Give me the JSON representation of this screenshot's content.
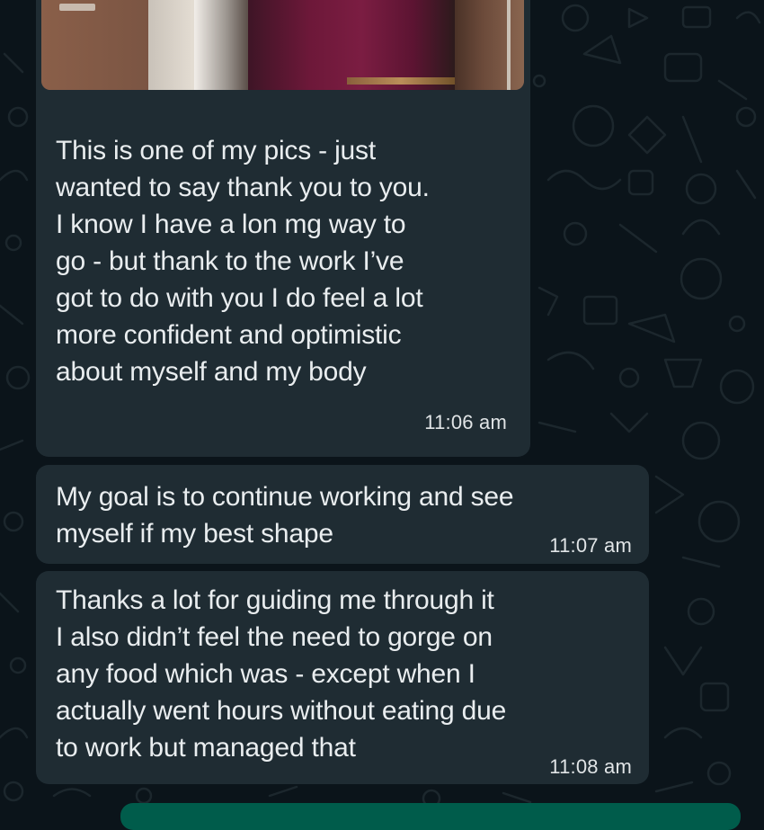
{
  "theme": {
    "background": "#0b141a",
    "incoming_bubble": "#1f2c33",
    "outgoing_bubble": "#005c4b",
    "text": "#e9edef"
  },
  "messages": [
    {
      "type": "image_with_caption",
      "direction": "incoming",
      "text": "This is one of my pics - just\nwanted to say thank you to you.\nI know I have a lon mg way to\ngo - but thank to the work I’ve\ngot to do with you I do feel a lot\nmore confident and optimistic\nabout myself and my body",
      "time": "11:06 am"
    },
    {
      "type": "text",
      "direction": "incoming",
      "text": "My goal is to continue working and see\nmyself if my best shape",
      "time": "11:07 am"
    },
    {
      "type": "text",
      "direction": "incoming",
      "text": "Thanks a lot for guiding me through it\nI also didn’t feel the need to gorge on\nany food which was - except when I\nactually went hours without eating due\nto work but managed that",
      "time": "11:08 am"
    },
    {
      "type": "text",
      "direction": "outgoing"
    }
  ]
}
